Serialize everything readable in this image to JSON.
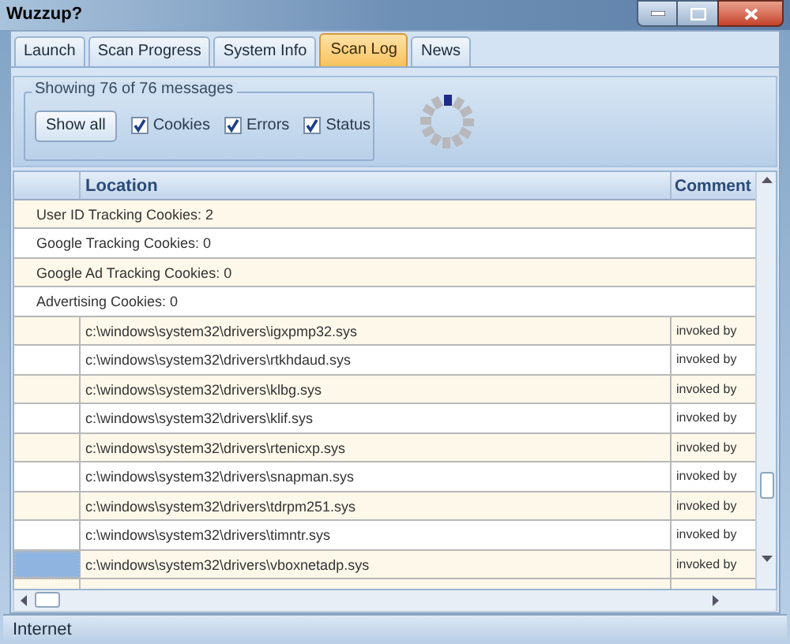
{
  "window": {
    "title": "Wuzzup?"
  },
  "tabs": [
    {
      "label": "Launch",
      "selected": false
    },
    {
      "label": "Scan Progress",
      "selected": false
    },
    {
      "label": "System Info",
      "selected": false
    },
    {
      "label": "Scan Log",
      "selected": true
    },
    {
      "label": "News",
      "selected": false
    }
  ],
  "filter": {
    "caption": "Showing 76 of 76 messages",
    "button": "Show all",
    "checkboxes": [
      {
        "label": "Cookies",
        "checked": true
      },
      {
        "label": "Errors",
        "checked": true
      },
      {
        "label": "Status",
        "checked": true
      }
    ]
  },
  "table": {
    "columns": [
      "Location",
      "Comment"
    ],
    "rows": [
      {
        "kind": "summary",
        "text": "User ID Tracking Cookies: 2",
        "selected": false
      },
      {
        "kind": "summary",
        "text": "Google Tracking Cookies: 0",
        "selected": false
      },
      {
        "kind": "summary",
        "text": "Google Ad Tracking Cookies: 0",
        "selected": false
      },
      {
        "kind": "summary",
        "text": "Advertising Cookies: 0",
        "selected": false
      },
      {
        "kind": "file",
        "location": "c:\\windows\\system32\\drivers\\igxpmp32.sys",
        "comment": "invoked by",
        "selected": false
      },
      {
        "kind": "file",
        "location": "c:\\windows\\system32\\drivers\\rtkhdaud.sys",
        "comment": "invoked by",
        "selected": false
      },
      {
        "kind": "file",
        "location": "c:\\windows\\system32\\drivers\\klbg.sys",
        "comment": "invoked by",
        "selected": false
      },
      {
        "kind": "file",
        "location": "c:\\windows\\system32\\drivers\\klif.sys",
        "comment": "invoked by",
        "selected": false
      },
      {
        "kind": "file",
        "location": "c:\\windows\\system32\\drivers\\rtenicxp.sys",
        "comment": "invoked by",
        "selected": false
      },
      {
        "kind": "file",
        "location": "c:\\windows\\system32\\drivers\\snapman.sys",
        "comment": "invoked by",
        "selected": false
      },
      {
        "kind": "file",
        "location": "c:\\windows\\system32\\drivers\\tdrpm251.sys",
        "comment": "invoked by",
        "selected": false
      },
      {
        "kind": "file",
        "location": "c:\\windows\\system32\\drivers\\timntr.sys",
        "comment": "invoked by",
        "selected": false
      },
      {
        "kind": "file",
        "location": "c:\\windows\\system32\\drivers\\vboxnetadp.sys",
        "comment": "invoked by",
        "selected": true
      }
    ]
  },
  "status_bar": "Internet"
}
